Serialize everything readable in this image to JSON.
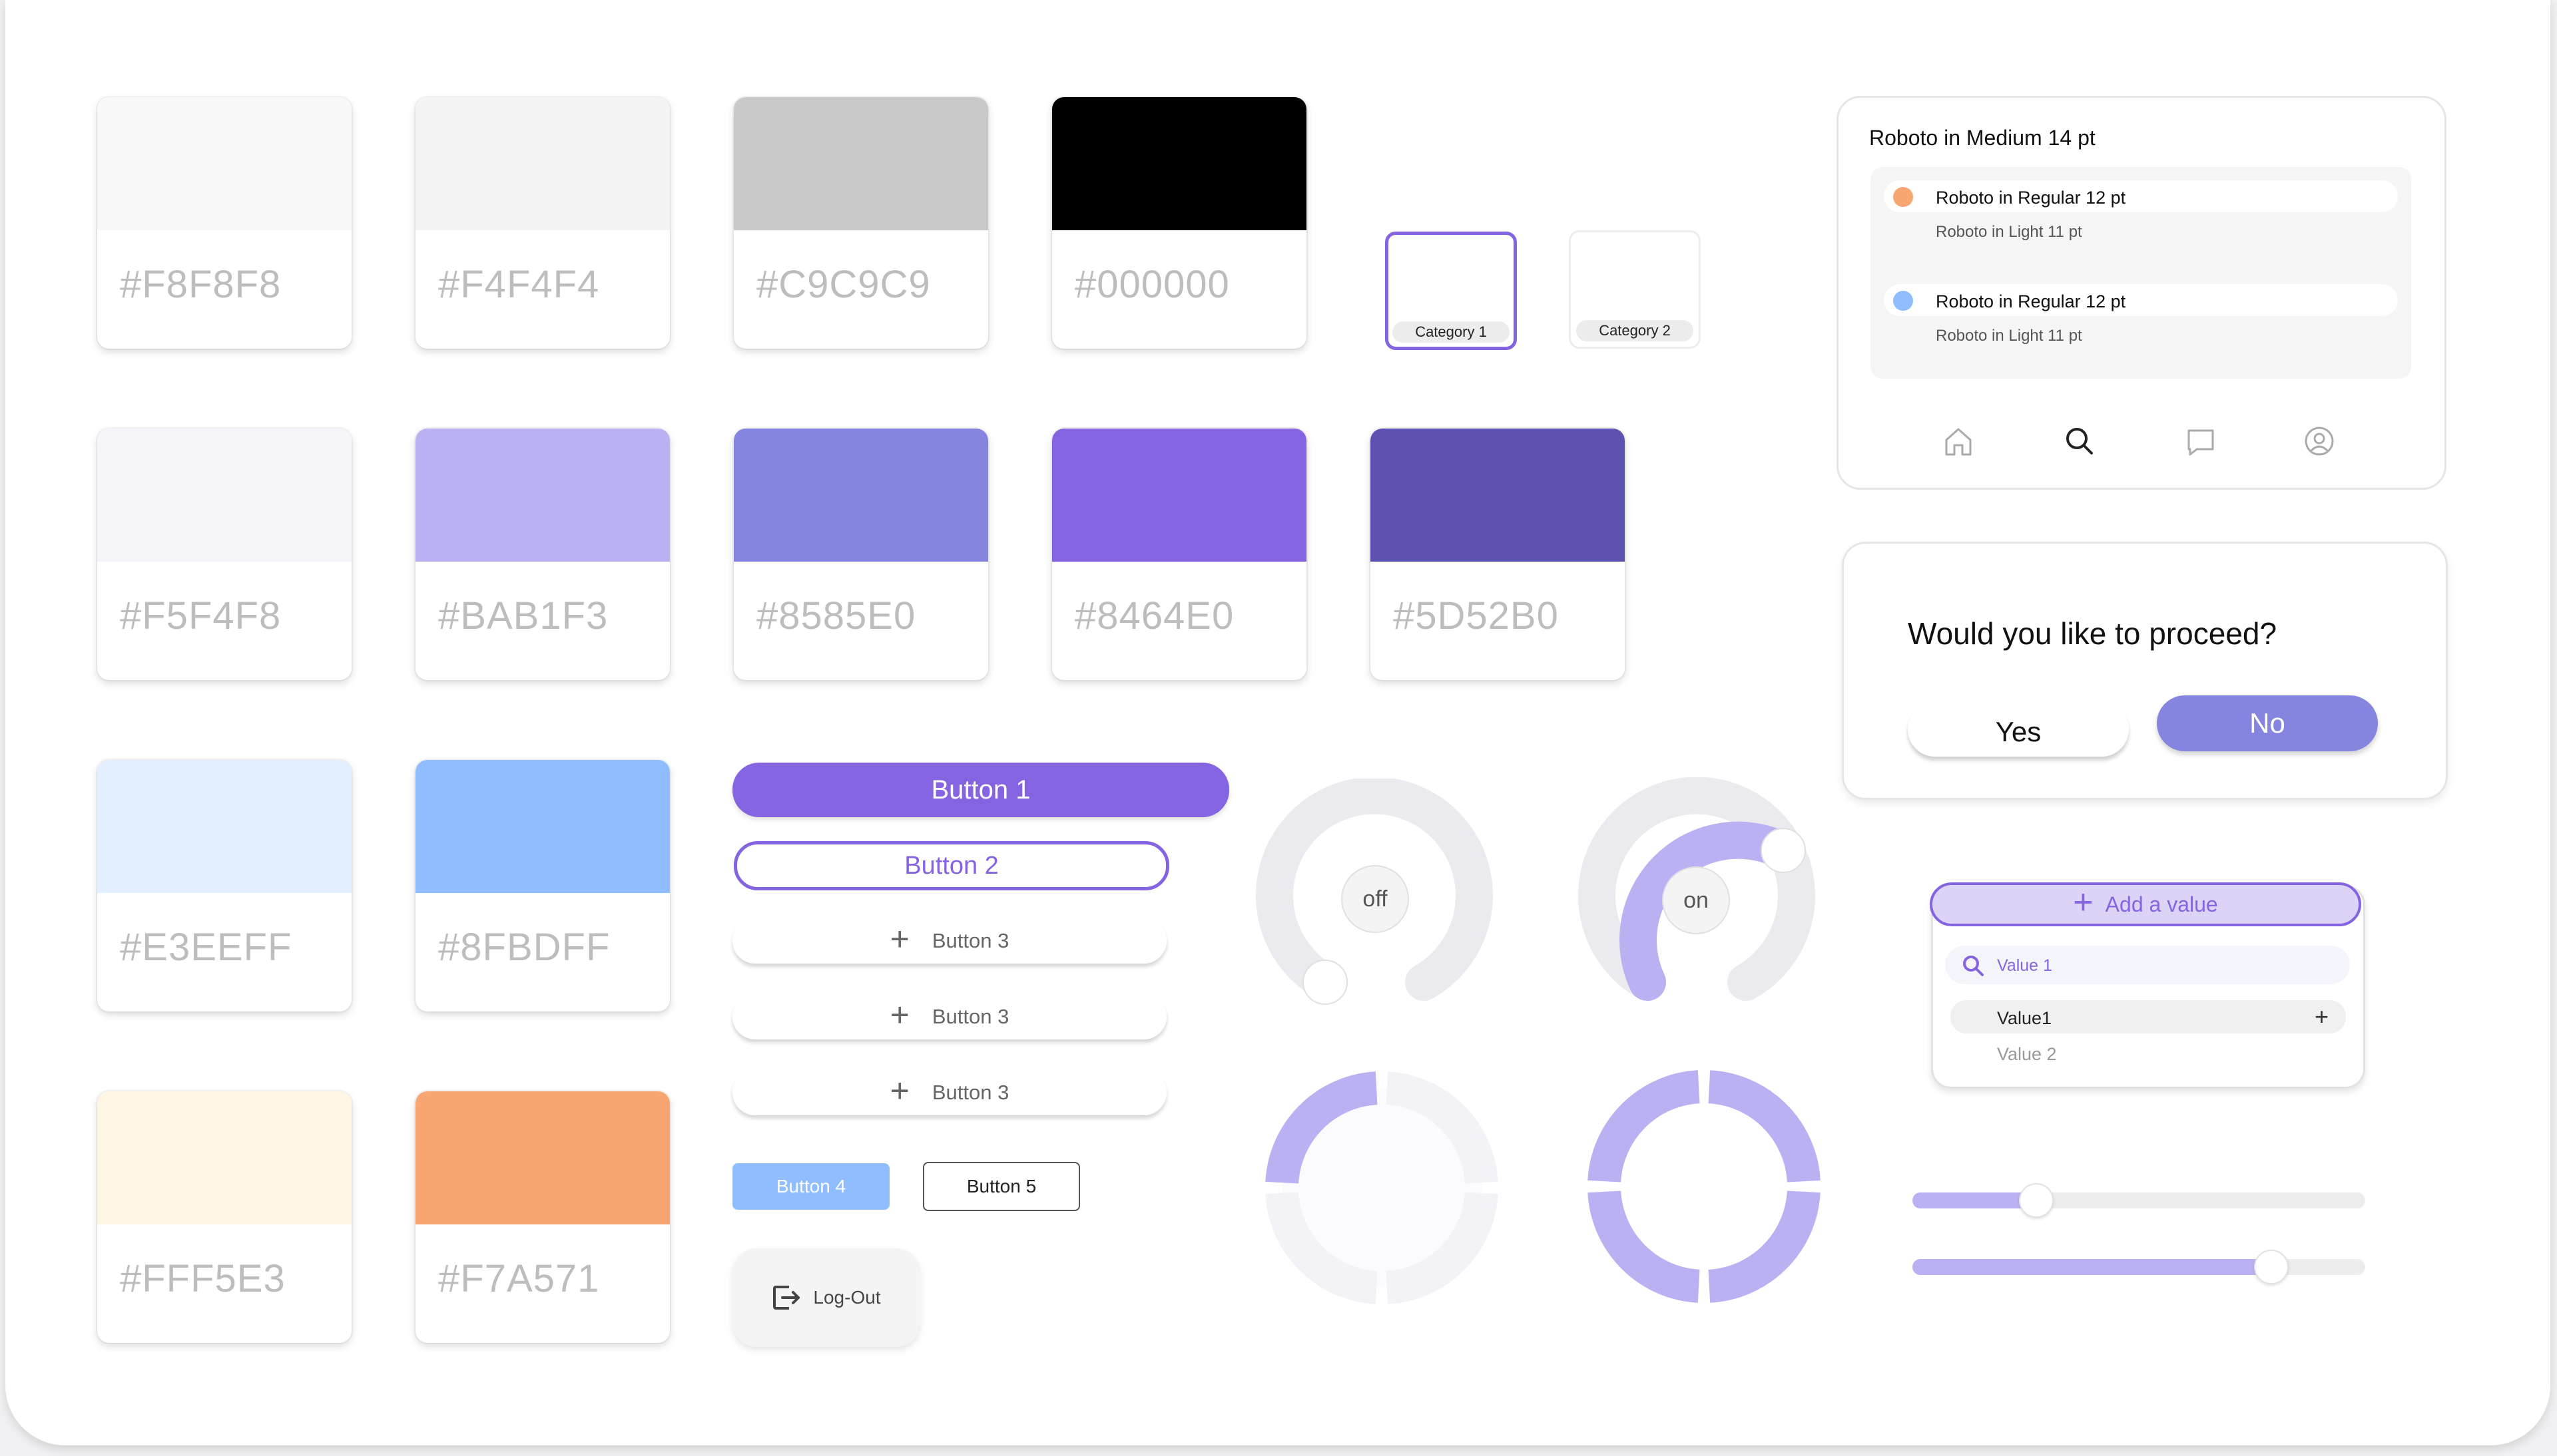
{
  "swatches": [
    {
      "hex": "#F8F8F8",
      "color": "#F8F8F8"
    },
    {
      "hex": "#F4F4F4",
      "color": "#F4F4F4"
    },
    {
      "hex": "#C9C9C9",
      "color": "#C9C9C9"
    },
    {
      "hex": "#000000",
      "color": "#000000"
    },
    {
      "hex": "#F5F4F8",
      "color": "#F5F4F8"
    },
    {
      "hex": "#BAB1F3",
      "color": "#BAB1F3"
    },
    {
      "hex": "#8585E0",
      "color": "#8585E0"
    },
    {
      "hex": "#8464E0",
      "color": "#8464E0"
    },
    {
      "hex": "#5D52B0",
      "color": "#5D52B0"
    },
    {
      "hex": "#E3EEFF",
      "color": "#E3EEFF"
    },
    {
      "hex": "#8FBDFF",
      "color": "#8FBDFF"
    },
    {
      "hex": "#FFF5E3",
      "color": "#FFF5E3"
    },
    {
      "hex": "#F7A571",
      "color": "#F7A571"
    }
  ],
  "categories": {
    "cat1": "Category 1",
    "cat2": "Category 2"
  },
  "buttons": {
    "b1": "Button 1",
    "b2": "Button 2",
    "b3": [
      "Button 3",
      "Button 3",
      "Button 3"
    ],
    "b4": "Button 4",
    "b5": "Button 5",
    "logout": "Log-Out"
  },
  "toggles": {
    "off": {
      "label": "off",
      "state": false
    },
    "on": {
      "label": "on",
      "state": true
    }
  },
  "progress_rings": [
    {
      "segments_filled": 1,
      "segments_total": 4
    },
    {
      "segments_filled": 4,
      "segments_total": 4
    }
  ],
  "list_card": {
    "title": "Roboto in Medium 14 pt",
    "items": [
      {
        "title": "Roboto in Regular 12 pt",
        "subtitle": "Roboto in Light 11 pt",
        "dot_color": "#F7A571"
      },
      {
        "title": "Roboto in Regular 12 pt",
        "subtitle": "Roboto in Light 11 pt",
        "dot_color": "#8FBDFF"
      }
    ],
    "nav_icons": [
      "home-icon",
      "search-icon",
      "chat-icon",
      "profile-icon"
    ],
    "active_nav": "search-icon"
  },
  "dialog": {
    "question": "Would you like to proceed?",
    "yes": "Yes",
    "no": "No"
  },
  "dropdown": {
    "add_label": "Add a value",
    "search_value": "Value 1",
    "options": [
      "Value1",
      "Value 2"
    ]
  },
  "sliders": [
    {
      "value": 0.27
    },
    {
      "value": 0.79
    }
  ],
  "colors": {
    "accent": "#8464E0",
    "accent_light": "#BAB1F3",
    "track": "#EBEBEF"
  }
}
